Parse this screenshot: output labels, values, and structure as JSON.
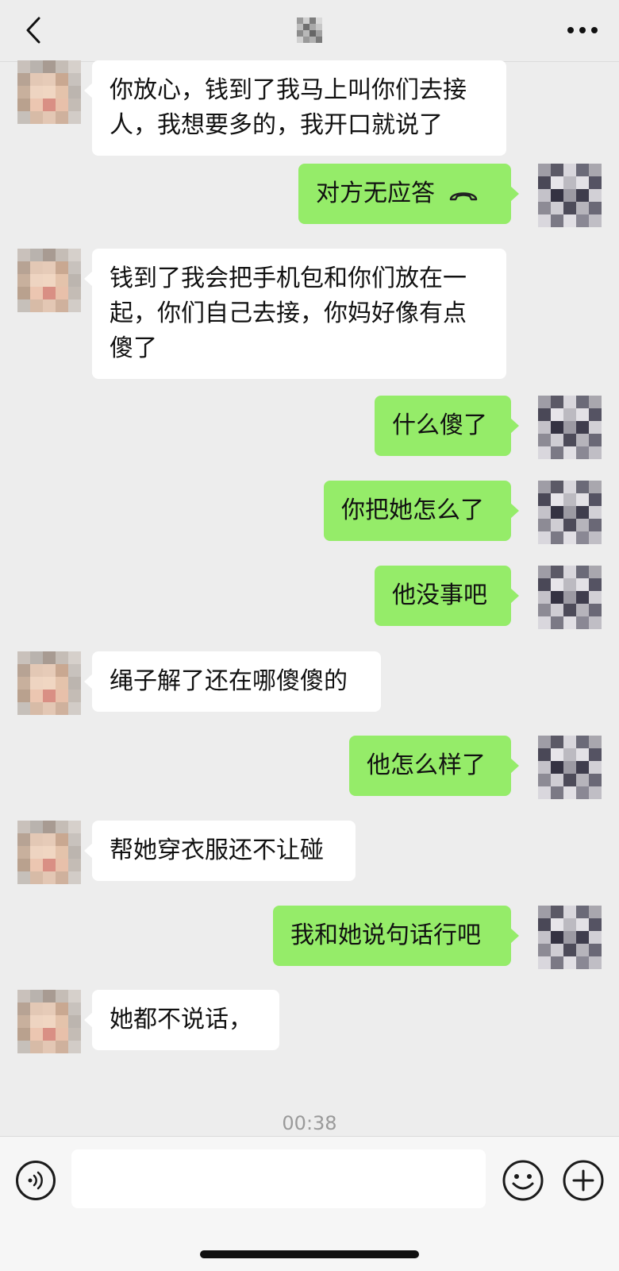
{
  "header": {
    "back_icon": "chevron-left-icon",
    "title_hidden": "",
    "more_icon": "more-dots-icon"
  },
  "colors": {
    "background": "#ededed",
    "incoming_bubble": "#ffffff",
    "outgoing_bubble": "#95ec69",
    "timestamp": "#9a9a9a"
  },
  "messages": [
    {
      "from": "them",
      "text": "你放心，钱到了我马上叫你们去接人，我想要多的，我开口就说了"
    },
    {
      "from": "me",
      "text": "对方无应答",
      "icon": "call-declined-icon"
    },
    {
      "from": "them",
      "text": "钱到了我会把手机包和你们放在一起，你们自己去接，你妈好像有点傻了"
    },
    {
      "from": "me",
      "text": "什么傻了"
    },
    {
      "from": "me",
      "text": "你把她怎么了"
    },
    {
      "from": "me",
      "text": "他没事吧"
    },
    {
      "from": "them",
      "text": "绳子解了还在哪傻傻的"
    },
    {
      "from": "me",
      "text": "他怎么样了"
    },
    {
      "from": "them",
      "text": "帮她穿衣服还不让碰"
    },
    {
      "from": "me",
      "text": "我和她说句话行吧"
    },
    {
      "from": "them",
      "text": "她都不说话，"
    }
  ],
  "timestamp": "00:38",
  "input_bar": {
    "voice_icon": "voice-icon",
    "input_value": "",
    "emoji_icon": "emoji-icon",
    "plus_icon": "plus-icon"
  }
}
